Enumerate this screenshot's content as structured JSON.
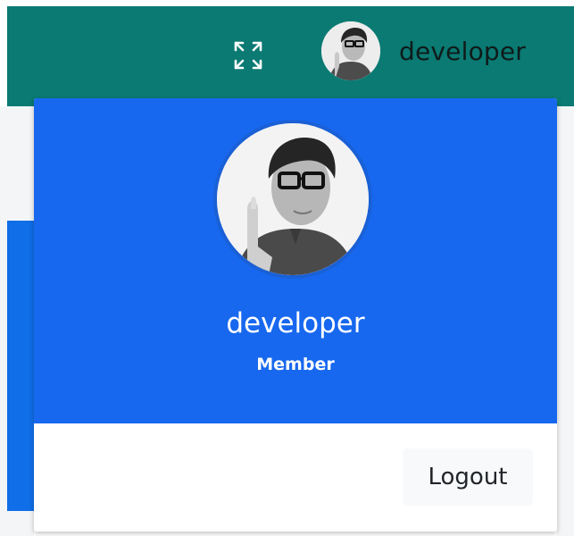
{
  "topbar": {
    "fullscreen_icon": "expand-arrows-icon",
    "username": "developer",
    "avatar": "user-avatar-photo"
  },
  "dropdown": {
    "name": "developer",
    "role": "Member",
    "logout_label": "Logout",
    "avatar": "user-avatar-photo"
  },
  "colors": {
    "topbar": "#0a7a73",
    "dropdown_header": "#1768ef",
    "logout_bg": "#f8f9fa"
  }
}
